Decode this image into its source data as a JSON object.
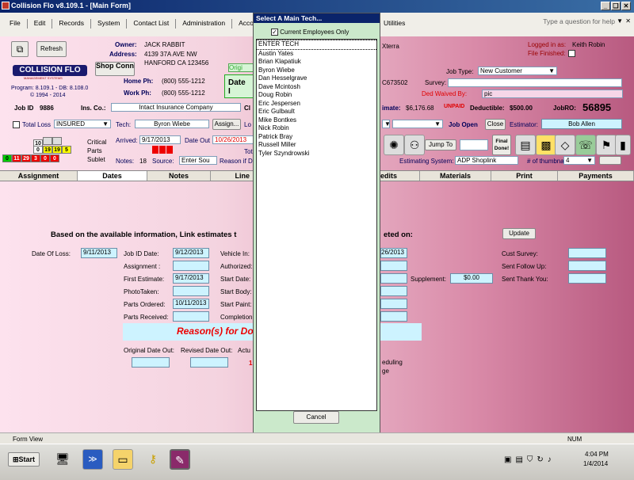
{
  "window": {
    "title": "Collision Flo v8.109.1 - [Main Form]",
    "btn_min": "_",
    "btn_max": "❑",
    "btn_close": "✕",
    "icon": "app-icon"
  },
  "menu": {
    "items": [
      "File",
      "Edit",
      "Records",
      "System",
      "Contact List",
      "Administration",
      "Accounting"
    ],
    "utilities": "Utilities",
    "help_placeholder": "Type a question for help",
    "pin": "▼",
    "close": "✕"
  },
  "toolbar": {
    "refresh": "Refresh",
    "shop": "Shop Conn"
  },
  "logo": {
    "text": "COLLISION FLO",
    "sub": "MANAGEMENT SYSTEMS",
    "program": "Program: 8.109.1 - DB: 8.108.0",
    "copyright": "© 1994 - 2014"
  },
  "owner": {
    "owner_label": "Owner:",
    "owner": "JACK RABBIT",
    "address_label": "Address:",
    "address1": "4139 37A AVE NW",
    "address2": "HANFORD CA 123456",
    "home_label": "Home Ph:",
    "home": "(800) 555-1212",
    "work_label": "Work Ph:",
    "work": "(800) 555-1212"
  },
  "vehicle": {
    "orig": "Origi",
    "date_i": "Date I",
    "model": "Xterra",
    "vin_tail": "C673502",
    "survey_label": "Survey:"
  },
  "login": {
    "logged_label": "Logged in as:",
    "user": "Keith Robin",
    "finished_label": "File Finished:"
  },
  "job": {
    "type_label": "Job Type:",
    "type": "New Customer",
    "ded_waived_label": "Ded Waived By:",
    "ded_waived": "pic",
    "estimate_label": "imate:",
    "estimate": "$6,176.68",
    "unpaid": "UNPAID",
    "deductible_label": "Deductible:",
    "deductible": "$500.00",
    "jobro_label": "JobRO:",
    "jobro": "56895"
  },
  "jobid": {
    "label": "Job ID",
    "value": "9886",
    "ins_label": "Ins. Co.:",
    "ins": "Intact Insurance Company",
    "cl": "Cl"
  },
  "tech": {
    "total_loss": "Total Loss",
    "insured": "INSURED",
    "label": "Tech:",
    "name": "Byron Wiebe",
    "assign": "Assign...",
    "lo": "Lo",
    "job_open": "Job Open",
    "close": "Close",
    "estimator_label": "Estimator:",
    "estimator": "Bob Allen"
  },
  "counts": {
    "row1": [
      "10",
      "",
      ""
    ],
    "row2": [
      "0",
      "19",
      "19",
      "5"
    ],
    "row3": [
      "0",
      "11",
      "29",
      "3",
      "0",
      "0"
    ],
    "critical": "Critical",
    "parts": "Parts",
    "sublet": "Sublet"
  },
  "dates_row": {
    "arrived_label": "Arrived:",
    "arrived": "9/17/2013",
    "out_label": "Date Out",
    "out": "10/26/2013",
    "tot": "Tot",
    "notes_label": "Notes:",
    "notes": "18",
    "source_label": "Source:",
    "source": "Enter Sou",
    "reason": "Reason if D"
  },
  "tools": {
    "jump_to": "Jump To",
    "final_done": "Final Done!",
    "est_sys_label": "Estimating System:",
    "est_sys": "ADP Shoplink",
    "thumbs_label": "# of thumbnails:",
    "thumbs": "4"
  },
  "tabs": [
    "Assignment",
    "Dates",
    "Notes",
    "Line",
    "edits",
    "Materials",
    "Print",
    "Payments"
  ],
  "dates": {
    "headline": "Based on the available information, Link estimates t",
    "headline2": "eted on:",
    "update": "Update",
    "loss_label": "Date Of Loss:",
    "loss": "9/11/2013",
    "jobid_label": "Job ID Date:",
    "jobid": "9/12/2013",
    "assign_label": "Assignment :",
    "first_label": "First Estimate:",
    "first": "9/17/2013",
    "photo_label": "PhotoTaken:",
    "ordered_label": "Parts Ordered:",
    "ordered": "10/11/2013",
    "received_label": "Parts Received:",
    "vin_label": "Vehicle In:",
    "auth_label": "Authorized:",
    "start_label": "Start Date:",
    "body_label": "Start Body:",
    "paint_label": "Start Paint:",
    "comp_label": "Completion:",
    "right_date": "26/2013",
    "supp_label": "Supplement:",
    "supp": "$0.00",
    "cust_label": "Cust Survey:",
    "follow_label": "Sent Follow Up:",
    "thank_label": "Sent Thank You:",
    "reasons": "Reason(s) for Do",
    "orig_out": "Original Date Out:",
    "rev_out": "Revised Date Out:",
    "actu": "Actu",
    "duling": "eduling",
    "ge": "ge"
  },
  "dialog": {
    "title": "Select A Main Tech...",
    "current_only": "Current Employees Only",
    "techs": [
      "ENTER TECH",
      "Austin Yates",
      "Brian Klapatiuk",
      "Byron Wiebe",
      "Dan Hesselgrave",
      "Dave Mcintosh",
      "Doug Robin",
      "Eric Jespersen",
      "Eric Gulbault",
      "Mike Bontkes",
      "Nick Robin",
      "Patrick Bray",
      "Russell Miller",
      "Tyler Szyndrowski"
    ],
    "cancel": "Cancel"
  },
  "status": {
    "left": "Form View",
    "num": "NUM"
  },
  "taskbar": {
    "start": "Start",
    "time": "4:04 PM",
    "date": "1/4/2014"
  }
}
